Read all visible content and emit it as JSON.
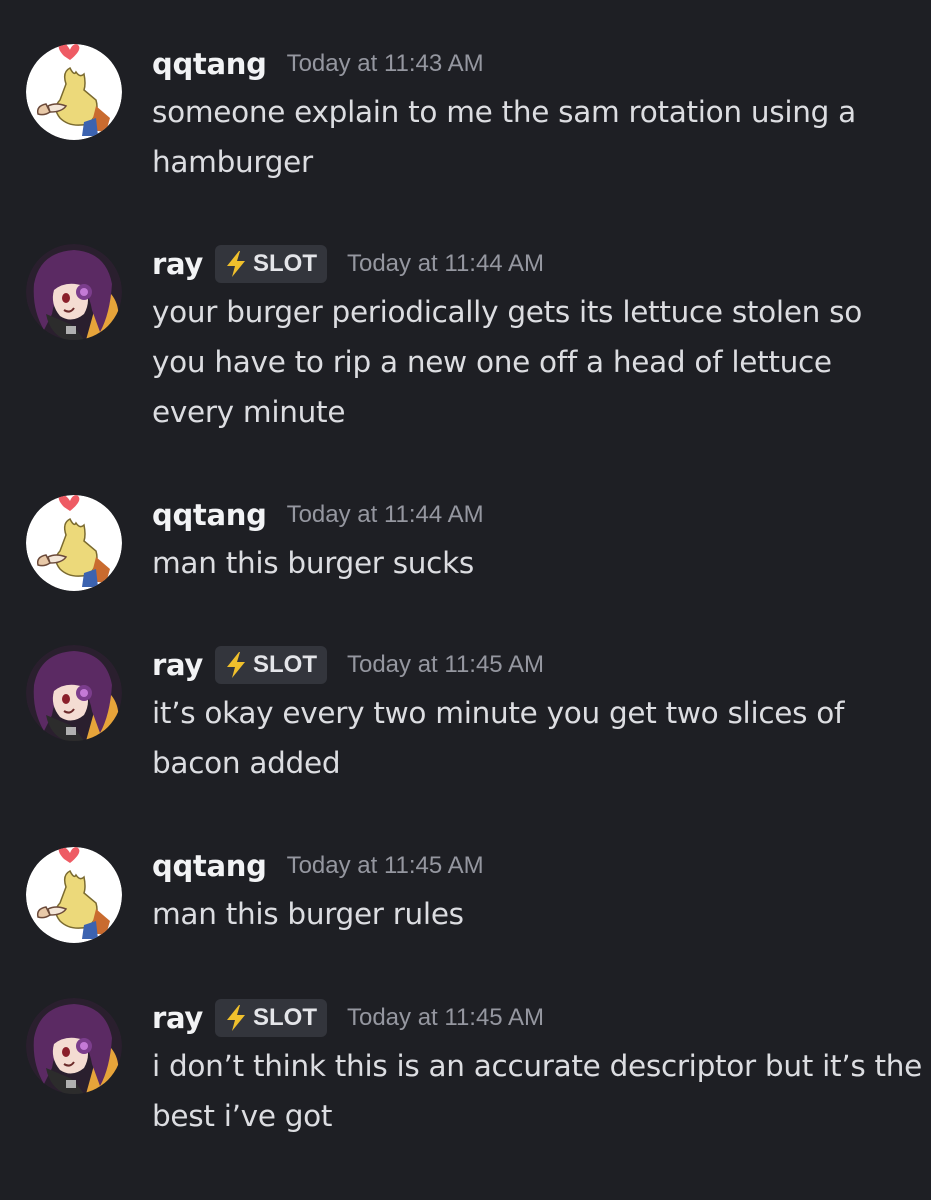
{
  "messages": [
    {
      "author": "qqtang",
      "tag": null,
      "timestamp": "Today at 11:43 AM",
      "text": "someone explain to me the sam rotation using a hamburger"
    },
    {
      "author": "ray",
      "tag": "SLOT",
      "timestamp": "Today at 11:44 AM",
      "text": "your burger periodically gets its lettuce stolen so you have to rip a new one off a head of lettuce every minute"
    },
    {
      "author": "qqtang",
      "tag": null,
      "timestamp": "Today at 11:44 AM",
      "text": "man this burger sucks"
    },
    {
      "author": "ray",
      "tag": "SLOT",
      "timestamp": "Today at 11:45 AM",
      "text": "it’s okay every two minute you get two slices of bacon added"
    },
    {
      "author": "qqtang",
      "tag": null,
      "timestamp": "Today at 11:45 AM",
      "text": "man this burger rules"
    },
    {
      "author": "ray",
      "tag": "SLOT",
      "timestamp": "Today at 11:45 AM",
      "text": "i don’t think this is an accurate descriptor but it’s the best i’ve got"
    }
  ],
  "icons": {
    "tag_icon": "lightning-bolt-icon",
    "qqtang_avatar": "chocobo-avatar",
    "ray_avatar": "purple-hair-character-avatar"
  },
  "colors": {
    "background": "#1e1f24",
    "username": "#f2f3f5",
    "message_text": "#dcdde1",
    "timestamp": "#9597a0",
    "tag_background": "#33353c",
    "tag_bolt": "#f0c02c"
  }
}
